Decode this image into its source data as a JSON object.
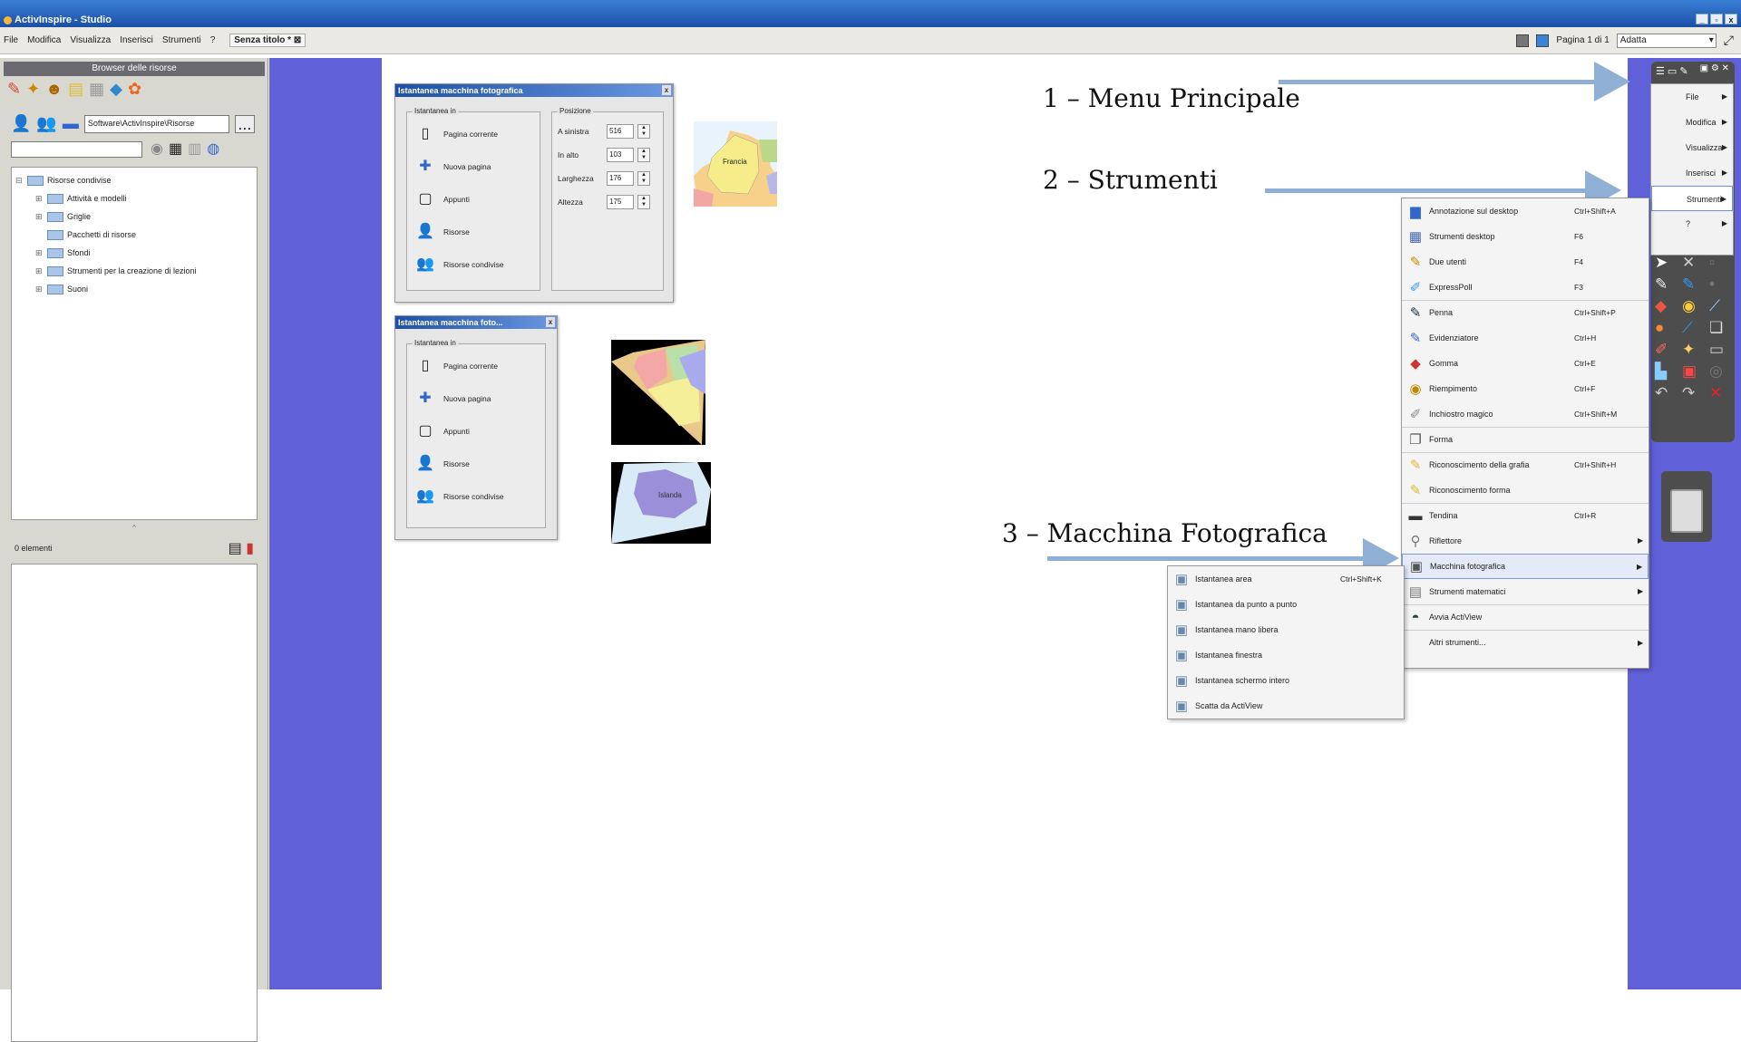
{
  "window": {
    "title": "ActivInspire - Studio",
    "controls": [
      "_",
      "▫",
      "x"
    ]
  },
  "menubar": {
    "items": [
      "File",
      "Modifica",
      "Visualizza",
      "Inserisci",
      "Strumenti",
      "?"
    ],
    "doc_tab": "Senza titolo *",
    "page_label": "Pagina 1 di 1",
    "zoom_value": "Adatta"
  },
  "browser": {
    "title": "Browser delle risorse",
    "path": "Software\\ActivInspire\\Risorse",
    "path_button": "...",
    "tree": [
      {
        "label": "Risorse condivise",
        "level": 0,
        "toggle": "⊟"
      },
      {
        "label": "Attività e modelli",
        "level": 1,
        "toggle": "⊞"
      },
      {
        "label": "Griglie",
        "level": 1,
        "toggle": "⊞"
      },
      {
        "label": "Pacchetti di risorse",
        "level": 1,
        "toggle": ""
      },
      {
        "label": "Sfondi",
        "level": 1,
        "toggle": "⊞"
      },
      {
        "label": "Strumenti per la creazione di lezioni",
        "level": 1,
        "toggle": "⊞"
      },
      {
        "label": "Suoni",
        "level": 1,
        "toggle": "⊞"
      }
    ],
    "count": "0 elementi"
  },
  "dialog1": {
    "title": "Istantanea macchina fotografica",
    "group1": "Istantanea in",
    "options": [
      "Pagina corrente",
      "Nuova pagina",
      "Appunti",
      "Risorse",
      "Risorse condivise"
    ],
    "group2": "Posizione",
    "positions": [
      {
        "label": "A sinistra",
        "value": "516"
      },
      {
        "label": "In alto",
        "value": "103"
      },
      {
        "label": "Larghezza",
        "value": "176"
      },
      {
        "label": "Altezza",
        "value": "175"
      }
    ]
  },
  "dialog2": {
    "title": "Istantanea macchina foto...",
    "group1": "Istantanea in",
    "options": [
      "Pagina corrente",
      "Nuova pagina",
      "Appunti",
      "Risorse",
      "Risorse condivise"
    ]
  },
  "maps": {
    "france": "Francia",
    "iceland": "Islanda"
  },
  "annotations": {
    "a1": "1 – Menu Principale",
    "a2": "2 – Strumenti",
    "a3": "3 – Macchina Fotografica"
  },
  "toolbox_menu": [
    {
      "label": "File",
      "arrow": "▶"
    },
    {
      "label": "Modifica",
      "arrow": "▶"
    },
    {
      "label": "Visualizza",
      "arrow": "▶"
    },
    {
      "label": "Inserisci",
      "arrow": "▶"
    },
    {
      "label": "Strumenti",
      "arrow": "▶"
    },
    {
      "label": "?",
      "arrow": "▶"
    }
  ],
  "tools_menu": [
    {
      "label": "Annotazione sul desktop",
      "shortcut": "Ctrl+Shift+A",
      "arrow": ""
    },
    {
      "label": "Strumenti desktop",
      "shortcut": "F6",
      "arrow": ""
    },
    {
      "label": "Due utenti",
      "shortcut": "F4",
      "arrow": ""
    },
    {
      "label": "ExpressPoll",
      "shortcut": "F3",
      "arrow": ""
    },
    {
      "label": "Penna",
      "shortcut": "Ctrl+Shift+P",
      "arrow": ""
    },
    {
      "label": "Evidenziatore",
      "shortcut": "Ctrl+H",
      "arrow": ""
    },
    {
      "label": "Gomma",
      "shortcut": "Ctrl+E",
      "arrow": ""
    },
    {
      "label": "Riempimento",
      "shortcut": "Ctrl+F",
      "arrow": ""
    },
    {
      "label": "Inchiostro magico",
      "shortcut": "Ctrl+Shift+M",
      "arrow": ""
    },
    {
      "label": "Forma",
      "shortcut": "",
      "arrow": ""
    },
    {
      "label": "Riconoscimento della grafia",
      "shortcut": "Ctrl+Shift+H",
      "arrow": ""
    },
    {
      "label": "Riconoscimento forma",
      "shortcut": "",
      "arrow": ""
    },
    {
      "label": "Tendina",
      "shortcut": "Ctrl+R",
      "arrow": ""
    },
    {
      "label": "Riflettore",
      "shortcut": "",
      "arrow": "▶"
    },
    {
      "label": "Macchina fotografica",
      "shortcut": "",
      "arrow": "▶"
    },
    {
      "label": "Strumenti matematici",
      "shortcut": "",
      "arrow": "▶"
    },
    {
      "label": "Avvia ActiView",
      "shortcut": "",
      "arrow": ""
    },
    {
      "label": "Altri strumenti...",
      "shortcut": "",
      "arrow": "▶"
    }
  ],
  "camera_menu": [
    {
      "label": "Istantanea area",
      "shortcut": "Ctrl+Shift+K"
    },
    {
      "label": "Istantanea da punto a punto",
      "shortcut": ""
    },
    {
      "label": "Istantanea mano libera",
      "shortcut": ""
    },
    {
      "label": "Istantanea finestra",
      "shortcut": ""
    },
    {
      "label": "Istantanea schermo intero",
      "shortcut": ""
    },
    {
      "label": "Scatta da ActiView",
      "shortcut": ""
    }
  ],
  "colors": {
    "purple": "#6060d8",
    "arrow": "#8fb0d4",
    "titlebar": "#1a4fa8"
  }
}
